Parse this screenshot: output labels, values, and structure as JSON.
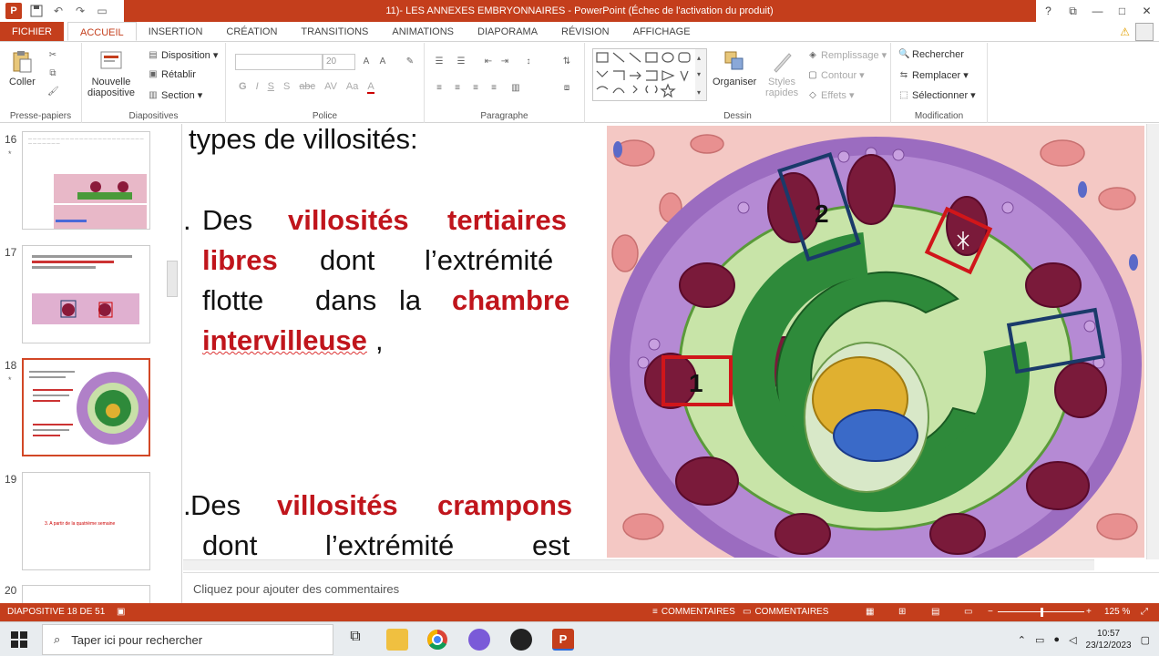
{
  "titlebar": {
    "title": "11)- LES ANNEXES EMBRYONNAIRES -  PowerPoint (Échec de l'activation du produit)",
    "logo": "P",
    "help": "?",
    "restore": "⧉",
    "minimize": "—",
    "maximize": "□"
  },
  "tabs": [
    "FICHIER",
    "ACCUEIL",
    "INSERTION",
    "CRÉATION",
    "TRANSITIONS",
    "ANIMATIONS",
    "DIAPORAMA",
    "RÉVISION",
    "AFFICHAGE"
  ],
  "ribbon": {
    "clipboard": {
      "paste": "Coller",
      "label": "Presse-papiers"
    },
    "slides": {
      "new_slide_1": "Nouvelle",
      "new_slide_2": "diapositive",
      "layout": "Disposition",
      "reset": "Rétablir",
      "section": "Section",
      "label": "Diapositives"
    },
    "font": {
      "size": "20",
      "label": "Police",
      "buttons": [
        "G",
        "I",
        "S",
        "S",
        "abc",
        "AV",
        "Aa",
        "A"
      ]
    },
    "paragraph": {
      "label": "Paragraphe"
    },
    "drawing": {
      "arrange": "Organiser",
      "quick_styles_1": "Styles",
      "quick_styles_2": "rapides",
      "fill": "Remplissage",
      "outline": "Contour",
      "effects": "Effets",
      "label": "Dessin"
    },
    "editing": {
      "find": "Rechercher",
      "replace": "Remplacer",
      "select": "Sélectionner",
      "label": "Modification"
    }
  },
  "thumbnails": [
    {
      "num": "16",
      "star": "*"
    },
    {
      "num": "17",
      "star": ""
    },
    {
      "num": "18",
      "star": "*"
    },
    {
      "num": "19",
      "star": "",
      "text": "3.    A partir de la quatrième semaine"
    },
    {
      "num": "20",
      "star": ""
    }
  ],
  "slide": {
    "line0": "types de villosités:",
    "bullet_a_marker": ".",
    "bullet_a_word1": "Des",
    "bullet_a_red1": "villosités",
    "bullet_a_red2": "tertiaires",
    "bullet_a_red3": "libres",
    "bullet_a_word2": "dont",
    "bullet_a_word3": "l’extrémité",
    "bullet_a_word4": "flotte",
    "bullet_a_word5": "dans",
    "bullet_a_word6": "la",
    "bullet_a_red4": "chambre",
    "bullet_a_red5": "intervilleuse",
    "bullet_a_comma": ",",
    "bullet_b_marker": ".",
    "bullet_b_word1": "Des",
    "bullet_b_red1": "villosités",
    "bullet_b_red2": "crampons",
    "bullet_b_word2": "dont",
    "bullet_b_word3": "l’extrémité",
    "bullet_b_word4": "est",
    "figure_label_1": "1",
    "figure_label_2": "2"
  },
  "notes": {
    "placeholder": "Cliquez pour ajouter des commentaires"
  },
  "statusbar": {
    "slide_info": "DIAPOSITIVE 18 DE 51",
    "comments1": "COMMENTAIRES",
    "comments2": "COMMENTAIRES",
    "zoom": "125 %"
  },
  "taskbar": {
    "search_placeholder": "Taper ici pour rechercher",
    "time": "10:57",
    "date": "23/12/2023"
  },
  "colors": {
    "accent": "#c43e1c",
    "slide_red": "#c0151c"
  }
}
